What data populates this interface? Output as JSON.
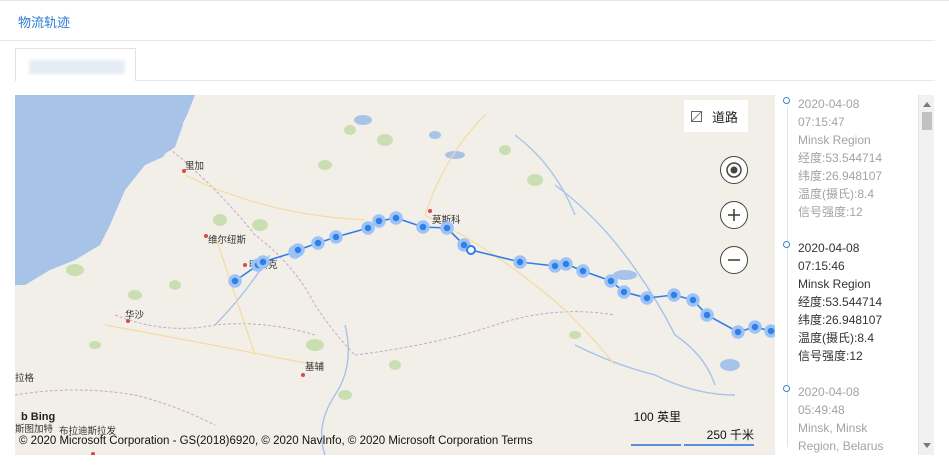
{
  "page": {
    "title": "物流轨迹"
  },
  "tab": {
    "label": ""
  },
  "map": {
    "road_toggle_label": "道路",
    "controls": [
      "locate-icon",
      "zoom-in-icon",
      "zoom-out-icon"
    ],
    "bing_label": "Bing",
    "copyright": "© 2020 Microsoft Corporation - GS(2018)6920, © 2020 NavInfo, © 2020 Microsoft Corporation Terms",
    "scale_a_label": "100 英里",
    "scale_b_label": "250 千米",
    "cities": [
      "里加",
      "维尔纽斯",
      "明斯克",
      "莫斯科",
      "华沙",
      "基辅",
      "布拉迪斯拉发",
      "斯图加特",
      "拉格"
    ],
    "colors": {
      "route": "#2f7fe6",
      "route_halo": "#9cc3f5",
      "water": "#a7c3e8",
      "land": "#f2efe9"
    }
  },
  "timeline": {
    "entries": [
      {
        "date": "2020-04-08",
        "time": "07:15:47",
        "region": "Minsk Region",
        "lng": "经度:53.544714",
        "lat": "纬度:26.948107",
        "temp": "温度(摄氏):8.4",
        "signal": "信号强度:12",
        "style": "faded"
      },
      {
        "date": "2020-04-08",
        "time": "07:15:46",
        "region": "Minsk Region",
        "lng": "经度:53.544714",
        "lat": "纬度:26.948107",
        "temp": "温度(摄氏):8.4",
        "signal": "信号强度:12",
        "style": "normal"
      },
      {
        "date": "2020-04-08",
        "time": "05:49:48",
        "region": "Minsk, Minsk",
        "region2": "Region, Belarus",
        "style": "faded"
      }
    ]
  }
}
